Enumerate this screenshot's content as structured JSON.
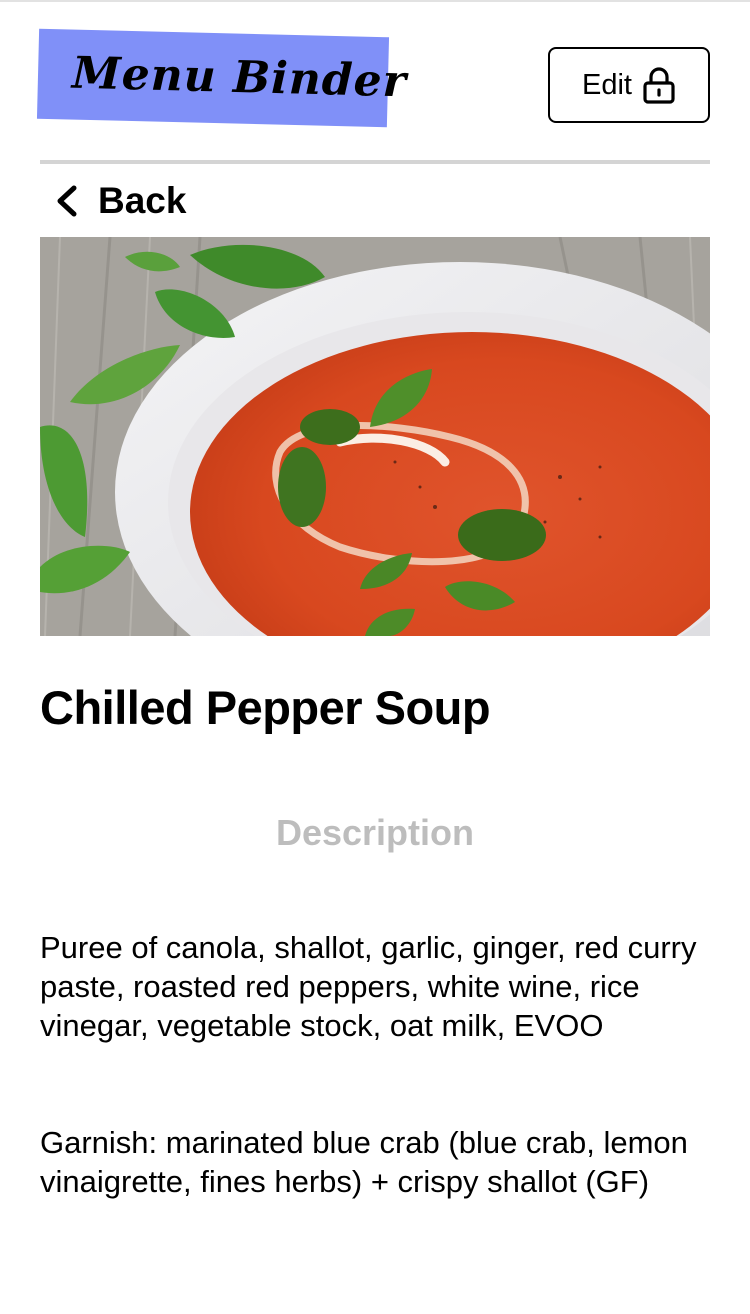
{
  "header": {
    "logo_text": "Menu Binder",
    "logo_color": "#8090f8",
    "edit_label": "Edit",
    "edit_icon": "lock-icon"
  },
  "nav": {
    "back_label": "Back",
    "back_icon": "chevron-left-icon"
  },
  "item": {
    "image_icon": "tomato-soup-photo",
    "title": "Chilled Pepper Soup",
    "section_heading": "Description",
    "description_paragraph_1": "Puree of canola, shallot, garlic, ginger, red curry paste, roasted red peppers, white wine, rice vinegar, vegetable stock, oat milk, EVOO",
    "description_paragraph_2": "Garnish: marinated blue crab (blue crab, lemon vinaigrette, fines herbs) + crispy shallot (GF)"
  }
}
